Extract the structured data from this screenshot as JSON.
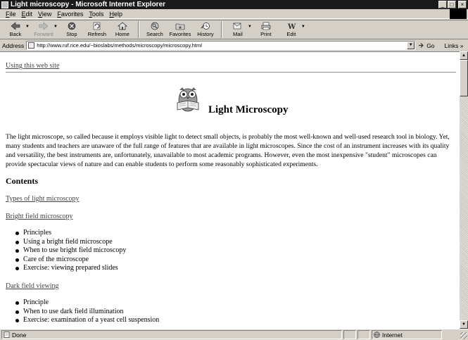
{
  "window": {
    "title": "Light microscopy - Microsoft Internet Explorer",
    "controls": {
      "minimize": "_",
      "maximize": "□",
      "close": "×"
    }
  },
  "menu": [
    {
      "label": "File"
    },
    {
      "label": "Edit"
    },
    {
      "label": "View"
    },
    {
      "label": "Favorites"
    },
    {
      "label": "Tools"
    },
    {
      "label": "Help"
    }
  ],
  "toolbar": {
    "back": "Back",
    "forward": "Forward",
    "stop": "Stop",
    "refresh": "Refresh",
    "home": "Home",
    "search": "Search",
    "favorites": "Favorites",
    "history": "History",
    "mail": "Mail",
    "print": "Print",
    "edit": "Edit"
  },
  "address": {
    "label": "Address",
    "url": "http://www.ruf.rice.edu/~bioslabs/methods/microscopy/microscopy.html",
    "go": "Go",
    "links": "Links"
  },
  "page": {
    "usage_link": "Using this web site",
    "title": "Light Microscopy",
    "intro": "The light microscope, so called because it employs visible light to detect small objects, is probably the most well-known and well-used research tool in biology. Yet, many students and teachers are unaware of the full range of features that are available in light microscopes. Since the cost of an instrument increases with its quality and versatility, the best instruments are, unfortunately, unavailable to most academic programs. However, even the most inexpensive \"student\" microscopes can provide spectacular views of nature and can enable students to perform some reasonably sophisticated experiments.",
    "contents_heading": "Contents",
    "sections": [
      {
        "link": "Types of light microscopy",
        "items": []
      },
      {
        "link": "Bright field microscopy",
        "items": [
          "Principles",
          "Using a bright field microscope",
          "When to use bright field microscopy",
          "Care of the microscope",
          "Exercise: viewing prepared slides"
        ]
      },
      {
        "link": "Dark field viewing",
        "items": [
          "Principle",
          "When to use dark field illumination",
          "Exercise: examination of a yeast cell suspension"
        ]
      }
    ]
  },
  "status": {
    "text": "Done",
    "zone": "Internet"
  }
}
